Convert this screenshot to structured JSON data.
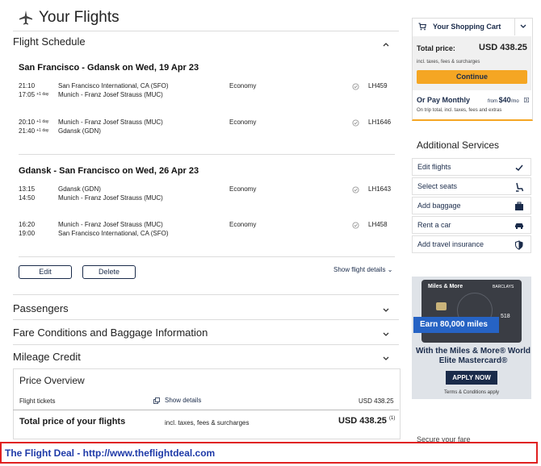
{
  "page": {
    "title": "Your Flights"
  },
  "schedule": {
    "heading": "Flight Schedule",
    "outbound": {
      "route": "San Francisco - Gdansk on Wed, 19 Apr 23",
      "legs": [
        {
          "dep_time": "21:10",
          "arr_time": "17:05",
          "day_offset": "+1 day",
          "from": "San Francisco International, CA (SFO)",
          "to": "Munich - Franz Josef Strauss (MUC)",
          "cabin": "Economy",
          "flight": "LH459"
        },
        {
          "dep_time": "20:10",
          "dep_offset": "+1 day",
          "arr_time": "21:40",
          "day_offset": "+1 day",
          "from": "Munich - Franz Josef Strauss (MUC)",
          "to": "Gdansk (GDN)",
          "cabin": "Economy",
          "flight": "LH1646"
        }
      ]
    },
    "inbound": {
      "route": "Gdansk - San Francisco on Wed, 26 Apr 23",
      "legs": [
        {
          "dep_time": "13:15",
          "arr_time": "14:50",
          "from": "Gdansk (GDN)",
          "to": "Munich - Franz Josef Strauss (MUC)",
          "cabin": "Economy",
          "flight": "LH1643"
        },
        {
          "dep_time": "16:20",
          "arr_time": "19:00",
          "from": "Munich - Franz Josef Strauss (MUC)",
          "to": "San Francisco International, CA (SFO)",
          "cabin": "Economy",
          "flight": "LH458"
        }
      ]
    },
    "edit_label": "Edit",
    "delete_label": "Delete",
    "details_label": "Show flight details"
  },
  "sections": {
    "passengers": "Passengers",
    "fare": "Fare Conditions and Baggage Information",
    "mileage": "Mileage Credit"
  },
  "price_overview": {
    "heading": "Price Overview",
    "tickets_label": "Flight tickets",
    "show_details": "Show details",
    "tickets_value": "USD 438.25",
    "total_label": "Total price of your flights",
    "total_note": "incl. taxes, fees & surcharges",
    "total_value": "USD 438.25",
    "footnote": "(1)"
  },
  "cart": {
    "heading": "Your Shopping Cart",
    "total_label": "Total price:",
    "total_value": "USD 438.25",
    "total_note": "incl. taxes, fees & surcharges",
    "continue_label": "Continue",
    "monthly_label": "Or Pay Monthly",
    "monthly_from": "from",
    "monthly_amount": "$40",
    "monthly_unit": "/mo",
    "monthly_note": "On trip total, incl. taxes, fees and extras"
  },
  "services": {
    "heading": "Additional Services",
    "items": [
      {
        "label": "Edit flights",
        "icon": "check-icon"
      },
      {
        "label": "Select seats",
        "icon": "seat-icon"
      },
      {
        "label": "Add baggage",
        "icon": "baggage-icon"
      },
      {
        "label": "Rent a car",
        "icon": "car-icon"
      },
      {
        "label": "Add travel insurance",
        "icon": "shield-icon"
      }
    ]
  },
  "ad": {
    "brand": "Miles & More",
    "bank": "BARCLAYS",
    "card_digits": "518",
    "earn": "Earn 80,000 miles",
    "headline": "With the Miles & More® World Elite Mastercard®",
    "apply": "APPLY NOW",
    "terms": "Terms & Conditions apply"
  },
  "secure_fare": "Secure your fare",
  "banner": {
    "text": "The Flight Deal - http://www.theflightdeal.com"
  },
  "colors": {
    "navy": "#1a2b4a",
    "accent": "#f5a623",
    "banner_border": "#e02020",
    "banner_text": "#1e3aa8"
  }
}
